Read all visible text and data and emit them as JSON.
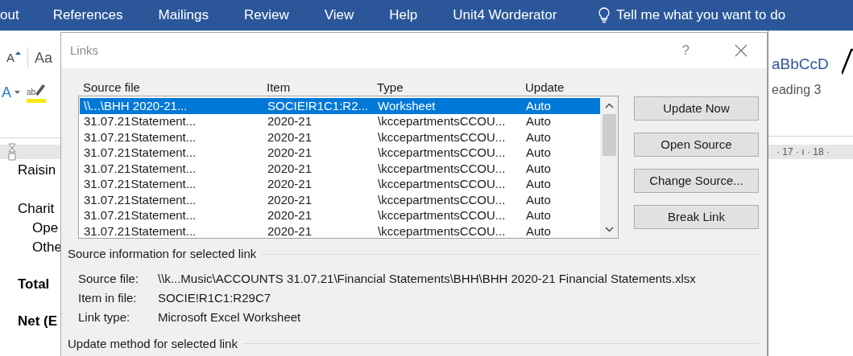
{
  "ribbon_tabs": [
    {
      "label": "out",
      "selected": false
    },
    {
      "label": "References",
      "selected": false
    },
    {
      "label": "Mailings",
      "selected": false
    },
    {
      "label": "Review",
      "selected": false
    },
    {
      "label": "View",
      "selected": false
    },
    {
      "label": "Help",
      "selected": false
    },
    {
      "label": "Unit4 Worderator",
      "selected": false
    }
  ],
  "tell_me": "Tell me what you want to do",
  "ribbon_left": {
    "grow_font": "A",
    "change_case": "Aa",
    "text_effects": "A",
    "highlight": "ab"
  },
  "styles_gallery": {
    "preview": "aBbCcD",
    "style_name": "eading 3"
  },
  "ruler": "· 17 · ı · 18 ·",
  "document_lines": [
    {
      "text": "Raisin",
      "bold": false,
      "indent": false
    },
    {
      "text": "Charit",
      "bold": false,
      "indent": false
    },
    {
      "text": "Ope",
      "bold": false,
      "indent": true
    },
    {
      "text": "Othe",
      "bold": false,
      "indent": true
    },
    {
      "text": "Total",
      "bold": true,
      "indent": false
    },
    {
      "text": "Net (E",
      "bold": true,
      "indent": false
    }
  ],
  "dialog": {
    "title": "Links",
    "help": "?",
    "columns": [
      "Source file",
      "Item",
      "Type",
      "Update"
    ],
    "rows": [
      {
        "cells": [
          "\\\\...\\BHH 2020-21...",
          "SOCIE!R1C1:R2...",
          "Worksheet",
          "Auto"
        ],
        "selected": true
      },
      {
        "cells": [
          "31.07.21Statement...",
          "2020-21",
          "\\kccepartmentsCCOU...",
          "Auto"
        ],
        "selected": false
      },
      {
        "cells": [
          "31.07.21Statement...",
          "2020-21",
          "\\kccepartmentsCCOU...",
          "Auto"
        ],
        "selected": false
      },
      {
        "cells": [
          "31.07.21Statement...",
          "2020-21",
          "\\kccepartmentsCCOU...",
          "Auto"
        ],
        "selected": false
      },
      {
        "cells": [
          "31.07.21Statement...",
          "2020-21",
          "\\kccepartmentsCCOU...",
          "Auto"
        ],
        "selected": false
      },
      {
        "cells": [
          "31.07.21Statement...",
          "2020-21",
          "\\kccepartmentsCCOU...",
          "Auto"
        ],
        "selected": false
      },
      {
        "cells": [
          "31.07.21Statement...",
          "2020-21",
          "\\kccepartmentsCCOU...",
          "Auto"
        ],
        "selected": false
      },
      {
        "cells": [
          "31.07.21Statement...",
          "2020-21",
          "\\kccepartmentsCCOU...",
          "Auto"
        ],
        "selected": false
      },
      {
        "cells": [
          "31.07.21Statement...",
          "2020-21",
          "\\kccepartmentsCCOU...",
          "Auto"
        ],
        "selected": false
      }
    ],
    "buttons": [
      "Update Now",
      "Open Source",
      "Change Source...",
      "Break Link"
    ],
    "source_info": {
      "heading": "Source information for selected link",
      "fields": [
        {
          "label": "Source file:",
          "value": "\\\\k...Music\\ACCOUNTS 31.07.21\\Financial Statements\\BHH\\BHH 2020-21 Financial Statements.xlsx"
        },
        {
          "label": "Item in file:",
          "value": "SOCIE!R1C1:R29C7"
        },
        {
          "label": "Link type:",
          "value": "Microsoft Excel Worksheet"
        }
      ]
    },
    "update_method": {
      "heading": "Update method for selected link"
    }
  }
}
